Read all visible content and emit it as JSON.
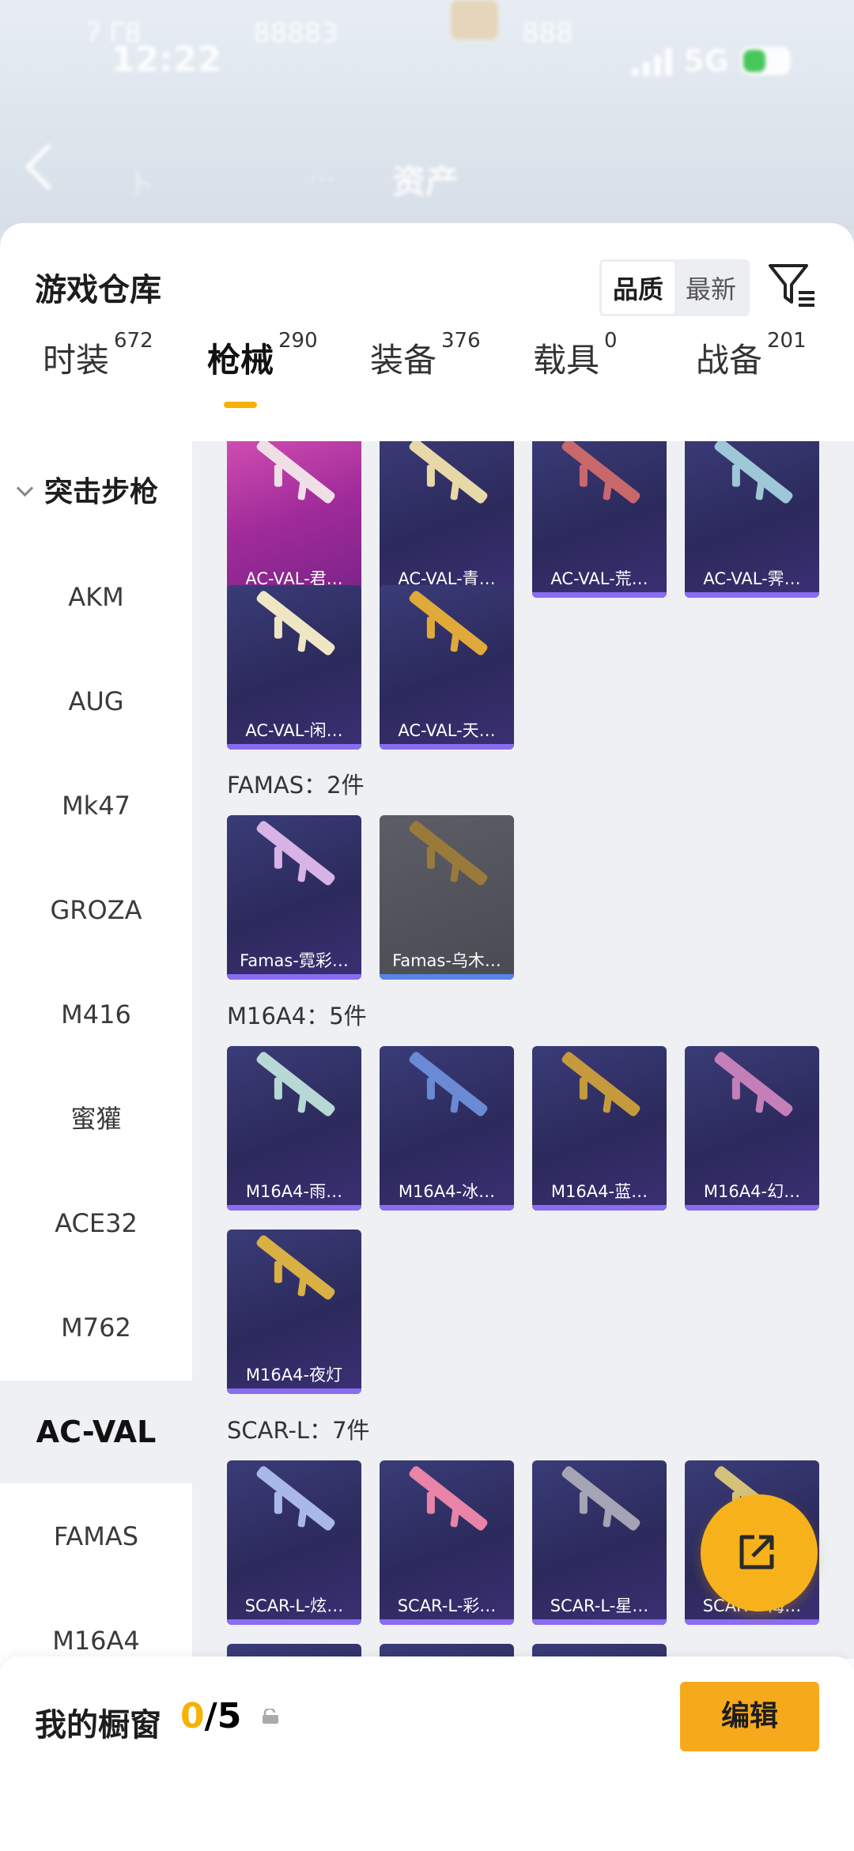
{
  "status_bar": {
    "time": "12:22",
    "network": "5G",
    "faint_left": "ʔ Γ8",
    "faint_center": "88883",
    "faint_right": "888"
  },
  "nav": {
    "title": "资产",
    "faint_left": "卜",
    "faint_mid": "⋯"
  },
  "sheet": {
    "title": "游戏仓库",
    "sort_options": [
      "品质",
      "最新"
    ],
    "sort_active": "品质",
    "tabs": [
      {
        "label": "时装",
        "count": "672"
      },
      {
        "label": "枪械",
        "count": "290"
      },
      {
        "label": "装备",
        "count": "376"
      },
      {
        "label": "载具",
        "count": "0"
      },
      {
        "label": "战备",
        "count": "201"
      }
    ],
    "active_tab": "枪械"
  },
  "categories": {
    "group": "突击步枪",
    "items": [
      "AKM",
      "AUG",
      "Mk47",
      "GROZA",
      "M416",
      "蜜獾",
      "ACE32",
      "M762",
      "AC-VAL",
      "FAMAS",
      "M16A4"
    ],
    "active": "AC-VAL"
  },
  "sections": [
    {
      "title": "",
      "items": [
        "AC-VAL-君…",
        "AC-VAL-青…",
        "AC-VAL-荒…",
        "AC-VAL-霁…",
        "AC-VAL-闲…",
        "AC-VAL-天…"
      ]
    },
    {
      "title": "FAMAS：2件",
      "items": [
        "Famas-霓彩…",
        "Famas-乌木…"
      ]
    },
    {
      "title": "M16A4：5件",
      "items": [
        "M16A4-雨…",
        "M16A4-冰…",
        "M16A4-蓝…",
        "M16A4-幻…",
        "M16A4-夜灯"
      ]
    },
    {
      "title": "SCAR-L：7件",
      "items": [
        "SCAR-L-炫…",
        "SCAR-L-彩…",
        "SCAR-L-星…",
        "SCAR-L-海…"
      ]
    }
  ],
  "bottom": {
    "label": "我的橱窗",
    "count_current": "0",
    "count_total": "/5",
    "edit_label": "编辑"
  },
  "colors": {
    "accent": "#f5b300",
    "button": "#f7a91c",
    "card_bg": "#2c2a5c",
    "card_pink": "#c23fae"
  },
  "icons": [
    "chevron-left-icon",
    "filter-icon",
    "chevron-down-icon",
    "share-out-icon",
    "lock-icon"
  ]
}
